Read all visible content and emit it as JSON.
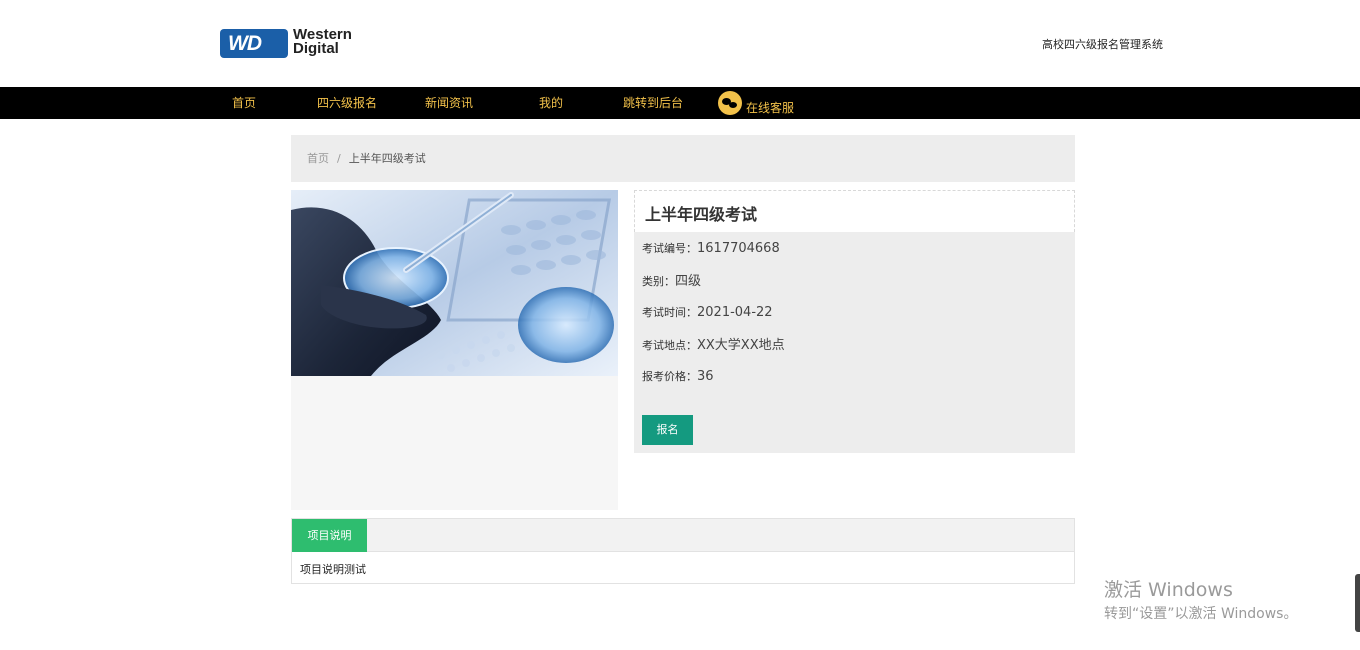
{
  "header": {
    "logo": {
      "badge_text": "WD",
      "wordmark_line1": "Western",
      "wordmark_line2": "Digital"
    },
    "system_title": "高校四六级报名管理系统"
  },
  "nav": {
    "items": [
      {
        "label": "首页"
      },
      {
        "label": "四六级报名"
      },
      {
        "label": "新闻资讯"
      },
      {
        "label": "我的"
      },
      {
        "label": "跳转到后台"
      }
    ],
    "customer_service": {
      "icon": "wechat-icon",
      "label": "在线客服"
    },
    "colors": {
      "bar": "#000000",
      "text": "#f2c14a"
    }
  },
  "breadcrumb": {
    "home": "首页",
    "separator": "/",
    "current": "上半年四级考试"
  },
  "exam": {
    "title": "上半年四级考试",
    "fields": [
      {
        "label": "考试编号：",
        "value": "1617704668"
      },
      {
        "label": "类别：",
        "value": "四级"
      },
      {
        "label": "考试时间：",
        "value": "2021-04-22"
      },
      {
        "label": "考试地点：",
        "value": "XX大学XX地点"
      },
      {
        "label": "报考价格：",
        "value": "36"
      }
    ],
    "signup_label": "报名",
    "signup_color": "#149a80"
  },
  "tabs": {
    "active_label": "项目说明",
    "active_color": "#2ebd6f",
    "content": "项目说明测试"
  },
  "watermark": {
    "line1": "激活 Windows",
    "line2": "转到“设置”以激活 Windows。"
  }
}
